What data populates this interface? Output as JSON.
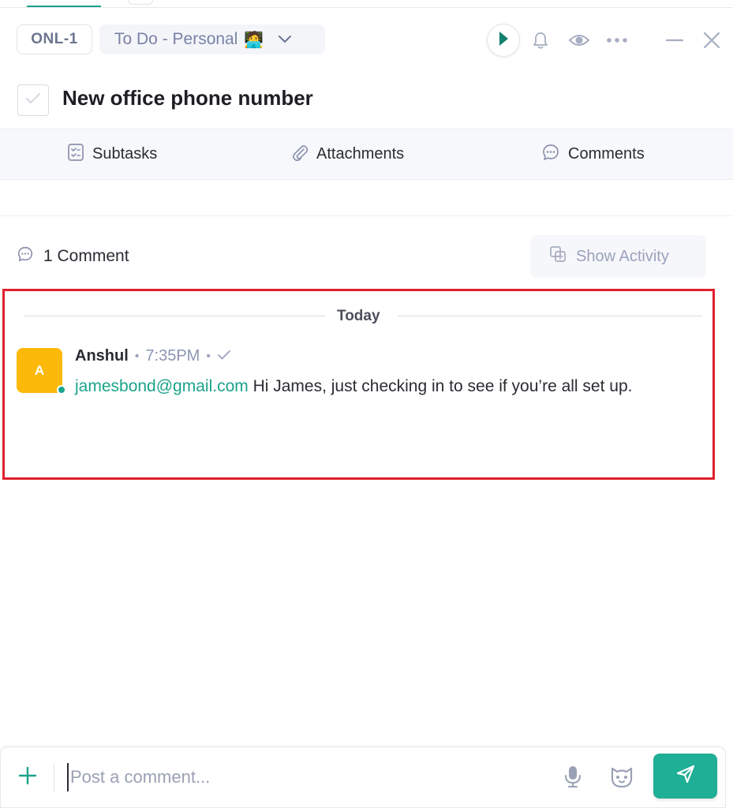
{
  "header": {
    "task_id": "ONL-1",
    "status_label": "To Do - Personal",
    "status_emoji": "🧑‍💻"
  },
  "task": {
    "title": "New office phone number"
  },
  "tabs": [
    {
      "label": "Subtasks",
      "icon": "checklist-icon"
    },
    {
      "label": "Attachments",
      "icon": "paperclip-icon"
    },
    {
      "label": "Comments",
      "icon": "comment-icon"
    }
  ],
  "comments": {
    "count_label": "1 Comment",
    "show_activity_label": "Show Activity",
    "day_label": "Today",
    "items": [
      {
        "avatar_letter": "A",
        "author": "Anshul",
        "time": "7:35PM",
        "mention": "jamesbond@gmail.com",
        "text": " Hi James, just checking in to see if you’re all set up."
      }
    ]
  },
  "composer": {
    "placeholder": "Post a comment..."
  },
  "colors": {
    "accent": "#1aa38a",
    "avatar": "#fdb909",
    "highlight": "#e0202d"
  }
}
